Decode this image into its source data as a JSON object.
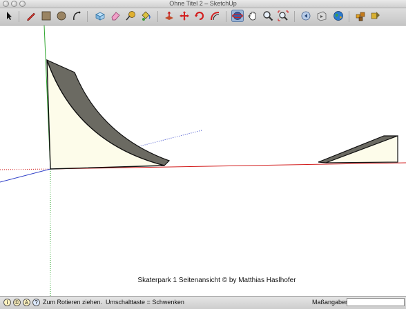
{
  "window": {
    "title": "Ohne Titel 2 – SketchUp"
  },
  "toolbar": {
    "tools": [
      {
        "name": "select-tool",
        "icon": "arrow-cursor-icon"
      },
      {
        "name": "pencil-tool",
        "icon": "pencil-icon"
      },
      {
        "name": "rectangle-tool",
        "icon": "rectangle-icon"
      },
      {
        "name": "circle-tool",
        "icon": "circle-icon"
      },
      {
        "name": "arc-tool",
        "icon": "arc-icon"
      },
      {
        "name": "make-component-tool",
        "icon": "component-box-icon"
      },
      {
        "name": "eraser-tool",
        "icon": "eraser-icon"
      },
      {
        "name": "tape-measure-tool",
        "icon": "tape-measure-icon"
      },
      {
        "name": "paint-bucket-tool",
        "icon": "paint-bucket-icon"
      },
      {
        "name": "push-pull-tool",
        "icon": "push-pull-icon"
      },
      {
        "name": "move-tool",
        "icon": "move-icon"
      },
      {
        "name": "rotate-tool",
        "icon": "rotate-icon"
      },
      {
        "name": "offset-tool",
        "icon": "offset-icon"
      },
      {
        "name": "orbit-tool",
        "icon": "orbit-icon"
      },
      {
        "name": "pan-tool",
        "icon": "hand-icon"
      },
      {
        "name": "zoom-tool",
        "icon": "magnifier-icon"
      },
      {
        "name": "zoom-extents-tool",
        "icon": "zoom-extents-icon"
      },
      {
        "name": "previous-view-tool",
        "icon": "previous-view-icon"
      },
      {
        "name": "next-view-tool",
        "icon": "next-view-icon"
      },
      {
        "name": "google-earth-tool",
        "icon": "globe-icon"
      },
      {
        "name": "components-tool",
        "icon": "components-icon"
      },
      {
        "name": "extension-tool",
        "icon": "extension-icon"
      }
    ]
  },
  "viewport": {
    "caption": "Skaterpark 1 Seitenansicht © by Matthias Haslhofer"
  },
  "statusbar": {
    "hint": "Zum Rotieren ziehen.  Umschalttaste = Schwenken",
    "measurements_label": "Maßangaben",
    "measurements_value": ""
  },
  "colors": {
    "face_front": "#fdfcea",
    "face_dark": "#6b6a62",
    "edge": "#111111",
    "axis_red": "#d21a1a",
    "axis_green": "#2fa62f",
    "axis_blue": "#3040c8"
  }
}
